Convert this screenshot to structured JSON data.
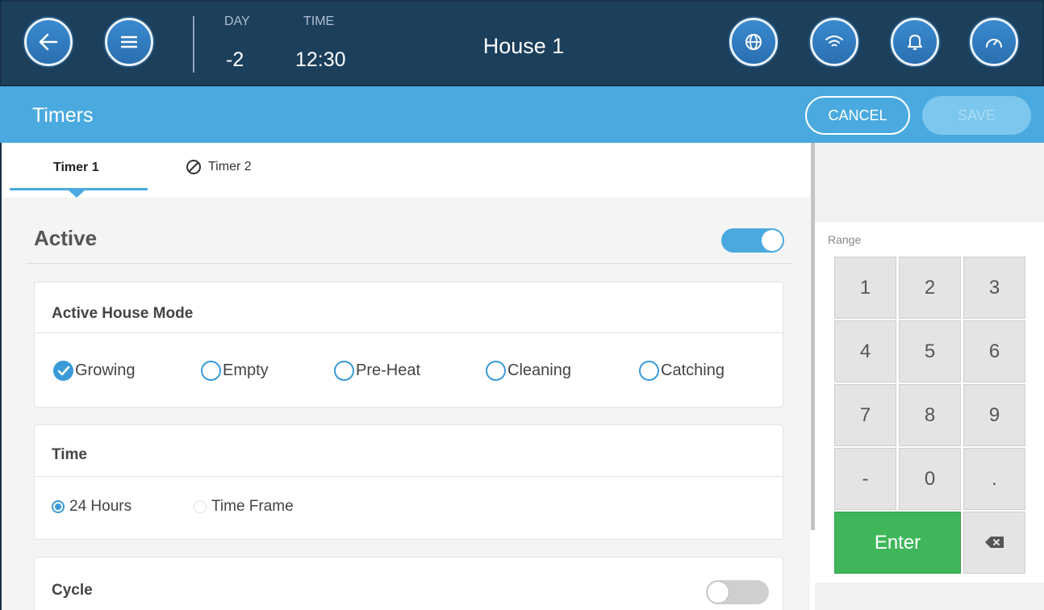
{
  "header": {
    "back_icon": "back-arrow-icon",
    "menu_icon": "hamburger-menu-icon",
    "day_label": "DAY",
    "day_value": "-2",
    "time_label": "TIME",
    "time_value": "12:30",
    "house_name": "House 1",
    "right_icons": [
      "globe-icon",
      "wifi-icon",
      "bell-icon",
      "gauge-icon"
    ]
  },
  "titlebar": {
    "title": "Timers",
    "cancel_label": "CANCEL",
    "save_label": "SAVE"
  },
  "tabs": [
    {
      "label": "Timer 1",
      "active": true
    },
    {
      "label": "Timer 2",
      "active": false,
      "icon": "disabled-circle-icon"
    }
  ],
  "active_section": {
    "title": "Active",
    "enabled": true
  },
  "house_mode": {
    "title": "Active House Mode",
    "options": [
      {
        "label": "Growing",
        "checked": true
      },
      {
        "label": "Empty",
        "checked": false
      },
      {
        "label": "Pre-Heat",
        "checked": false
      },
      {
        "label": "Cleaning",
        "checked": false
      },
      {
        "label": "Catching",
        "checked": false
      }
    ]
  },
  "time_section": {
    "title": "Time",
    "options": [
      {
        "label": "24 Hours",
        "selected": true
      },
      {
        "label": "Time Frame",
        "selected": false
      }
    ]
  },
  "cycle_section": {
    "title": "Cycle",
    "enabled": false
  },
  "keypad": {
    "range_label": "Range",
    "keys": [
      "1",
      "2",
      "3",
      "4",
      "5",
      "6",
      "7",
      "8",
      "9",
      "-",
      "0",
      "."
    ],
    "enter_label": "Enter",
    "backspace_icon": "backspace-icon"
  },
  "colors": {
    "header_bg": "#1c3f5c",
    "titlebar_bg": "#4aaadf",
    "accent": "#3a9bd8",
    "enter_green": "#3fb65a"
  }
}
